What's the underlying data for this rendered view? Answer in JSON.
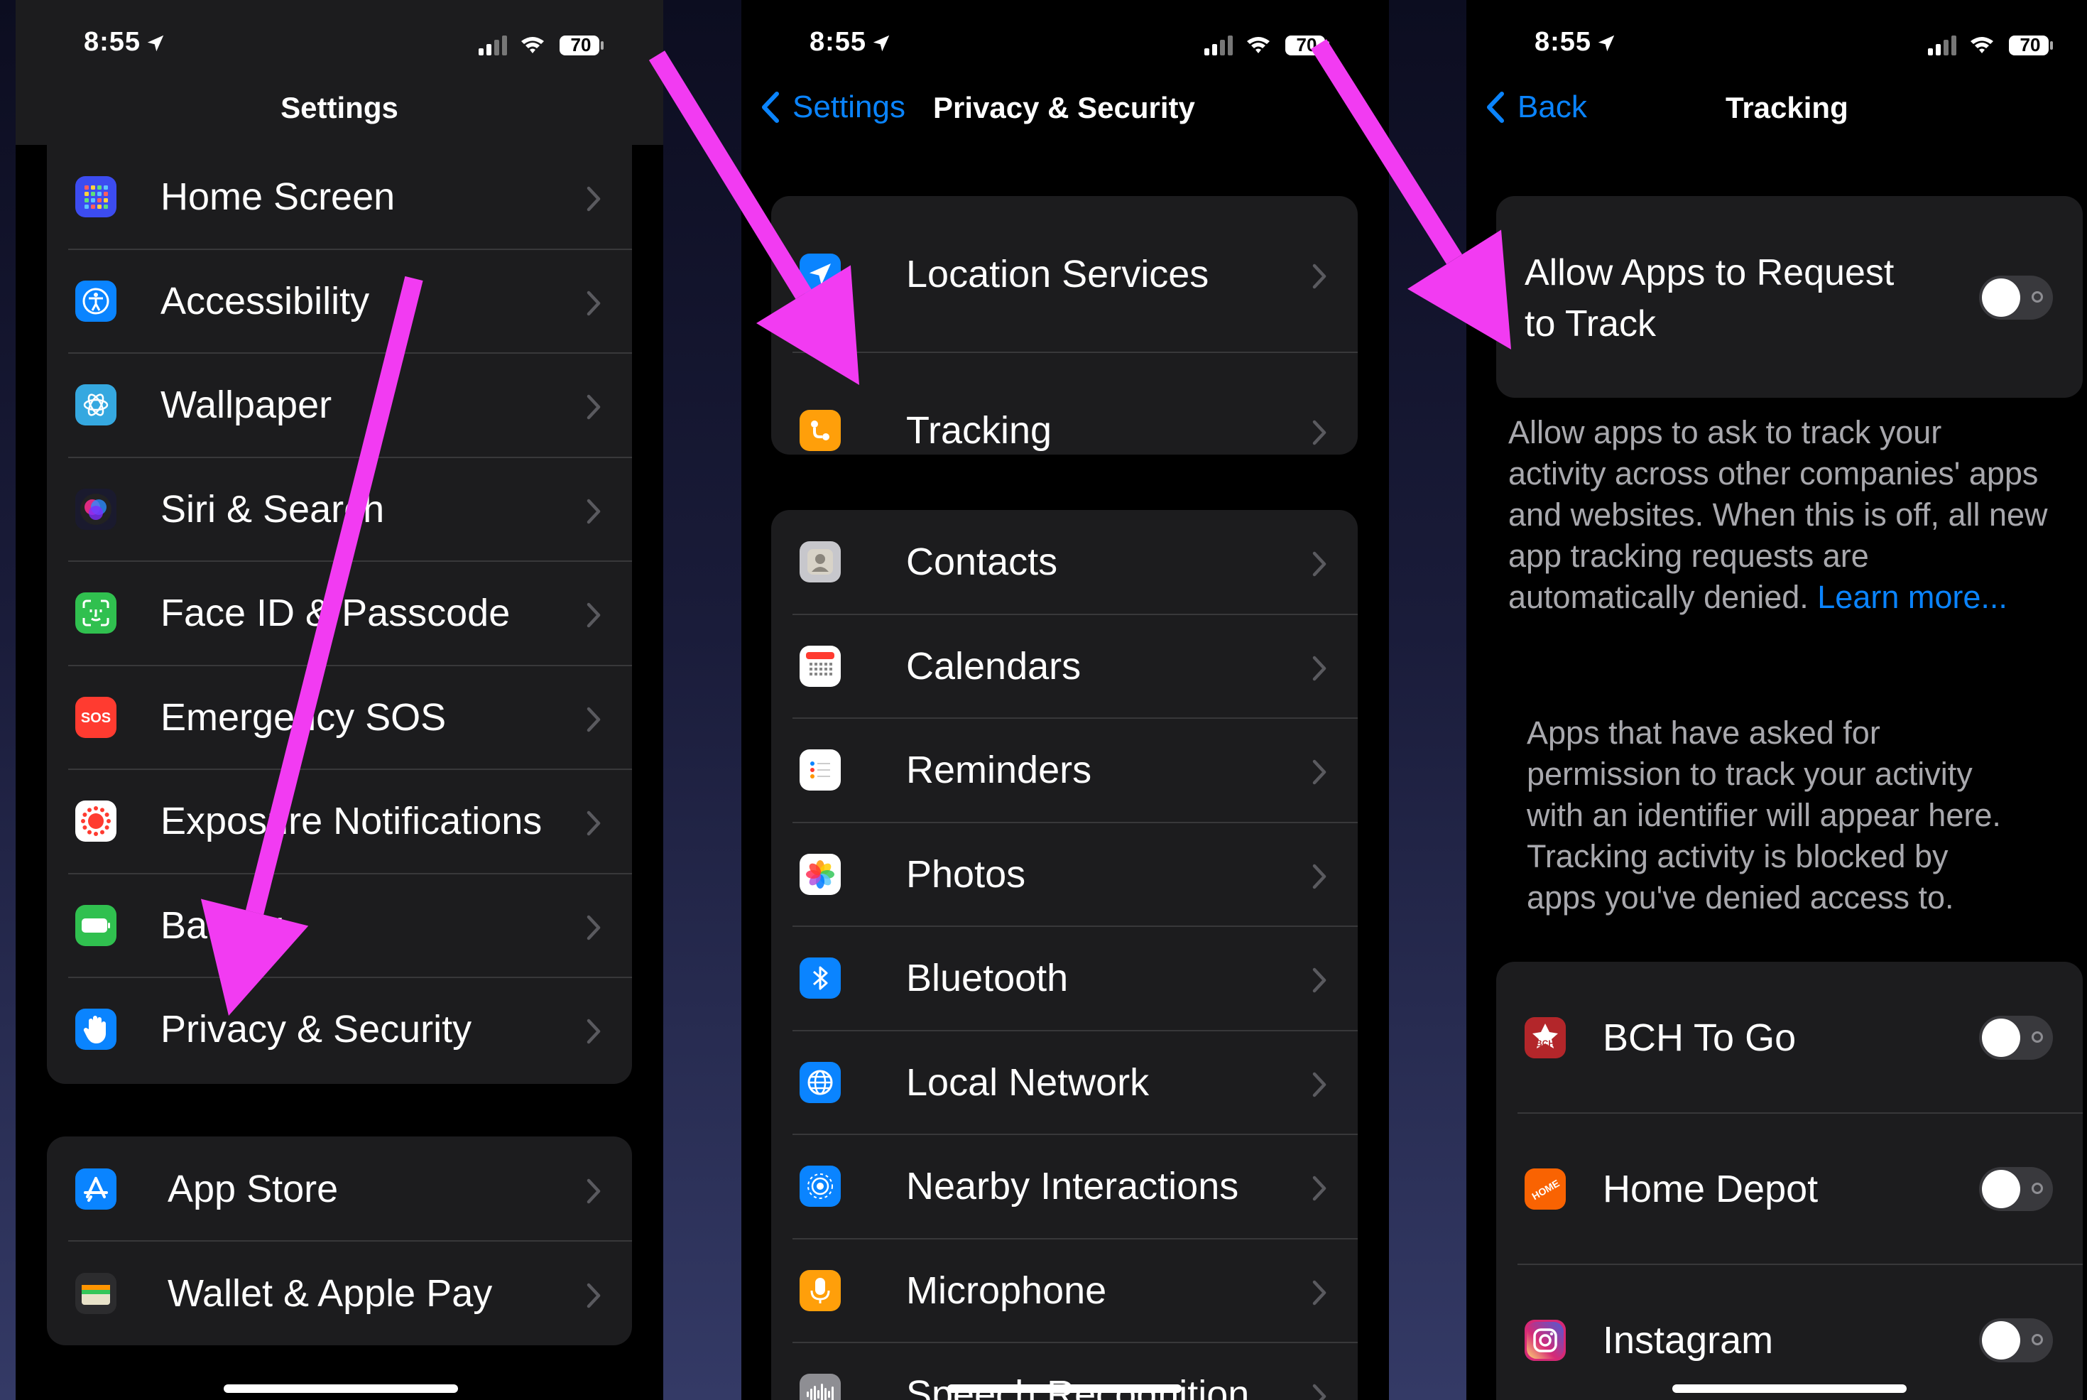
{
  "status": {
    "time": "8:55",
    "battery": "70"
  },
  "panel1": {
    "title": "Settings",
    "group1": [
      {
        "label": "Home Screen",
        "icon": "grid-icon",
        "color": "#3c4cf0"
      },
      {
        "label": "Accessibility",
        "icon": "accessibility-icon",
        "color": "#0a84ff"
      },
      {
        "label": "Wallpaper",
        "icon": "flower-icon",
        "color": "#35a8e0"
      },
      {
        "label": "Siri & Search",
        "icon": "siri-icon",
        "color": "#1a1a2e"
      },
      {
        "label": "Face ID & Passcode",
        "icon": "faceid-icon",
        "color": "#30c04f"
      },
      {
        "label": "Emergency SOS",
        "icon": "sos-icon",
        "color": "#ff3b30"
      },
      {
        "label": "Exposure Notifications",
        "icon": "exposure-icon",
        "color": "#ffffff"
      },
      {
        "label": "Battery",
        "icon": "battery-icon",
        "color": "#30c04f"
      },
      {
        "label": "Privacy & Security",
        "icon": "hand-icon",
        "color": "#0a84ff"
      }
    ],
    "group2": [
      {
        "label": "App Store",
        "icon": "appstore-icon",
        "color": "#0a84ff"
      },
      {
        "label": "Wallet & Apple Pay",
        "icon": "wallet-icon",
        "color": "#2c2c2e"
      }
    ]
  },
  "panel2": {
    "back": "Settings",
    "title": "Privacy & Security",
    "group1": [
      {
        "label": "Location Services",
        "icon": "location-icon",
        "color": "#0a84ff"
      },
      {
        "label": "Tracking",
        "icon": "tracking-icon",
        "color": "#ff9f0a"
      }
    ],
    "group2": [
      {
        "label": "Contacts",
        "icon": "contacts-icon",
        "color": "#c7c7cc"
      },
      {
        "label": "Calendars",
        "icon": "calendar-icon",
        "color": "#ffffff"
      },
      {
        "label": "Reminders",
        "icon": "reminders-icon",
        "color": "#ffffff"
      },
      {
        "label": "Photos",
        "icon": "photos-icon",
        "color": "#ffffff"
      },
      {
        "label": "Bluetooth",
        "icon": "bluetooth-icon",
        "color": "#0a84ff"
      },
      {
        "label": "Local Network",
        "icon": "globe-icon",
        "color": "#0a84ff"
      },
      {
        "label": "Nearby Interactions",
        "icon": "nearby-icon",
        "color": "#0a84ff"
      },
      {
        "label": "Microphone",
        "icon": "microphone-icon",
        "color": "#ff9f0a"
      },
      {
        "label": "Speech Recognition",
        "icon": "waveform-icon",
        "color": "#8e8e93"
      }
    ]
  },
  "panel3": {
    "back": "Back",
    "title": "Tracking",
    "allow_label_line1": "Allow Apps to Request",
    "allow_label_line2": "to Track",
    "desc_lines": [
      "Allow apps to ask to track your",
      "activity across other companies' apps",
      "and websites. When this is off, all new",
      "app tracking requests are",
      "automatically denied."
    ],
    "learn_more": "Learn more...",
    "asked_lines": [
      "Apps that have asked for",
      "permission to track your activity",
      "with an identifier will appear here.",
      "Tracking activity is blocked by",
      "apps you've denied access to."
    ],
    "apps": [
      {
        "label": "BCH To Go",
        "icon": "bch-icon",
        "color": "#b3262a",
        "enabled": false
      },
      {
        "label": "Home Depot",
        "icon": "homedepot-icon",
        "color": "#f96302",
        "enabled": false
      },
      {
        "label": "Instagram",
        "icon": "instagram-icon",
        "color": "#d62976",
        "enabled": false
      }
    ]
  },
  "arrow_color": "#f23bf2"
}
